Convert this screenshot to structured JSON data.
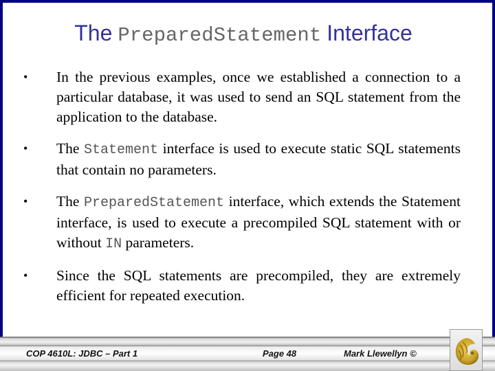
{
  "slide": {
    "title": {
      "prefix": "The",
      "code": "PreparedStatement",
      "suffix": "Interface"
    },
    "bullets": [
      {
        "text": "In the previous examples, once we established a connection to a particular database, it was used to send an SQL statement from the application to the database."
      },
      {
        "before": "The ",
        "code": "Statement",
        "after": " interface is used to execute static SQL statements that contain no parameters."
      },
      {
        "before": "The ",
        "code": "PreparedStatement",
        "after": " interface, which extends the Statement interface, is used to execute a precompiled SQL statement with or without ",
        "code2": "IN",
        "after2": " parameters."
      },
      {
        "text": "Since the SQL statements are precompiled, they are extremely efficient for repeated execution."
      }
    ],
    "bullet_glyph": "•"
  },
  "footer": {
    "course": "COP 4610L: JDBC – Part 1",
    "page": "Page 48",
    "author": "Mark Llewellyn ©",
    "logo_icon": "pegasus-logo-icon"
  },
  "colors": {
    "frame_border": "#000080",
    "title": "#333399",
    "logo_gold": "#c9a227"
  }
}
